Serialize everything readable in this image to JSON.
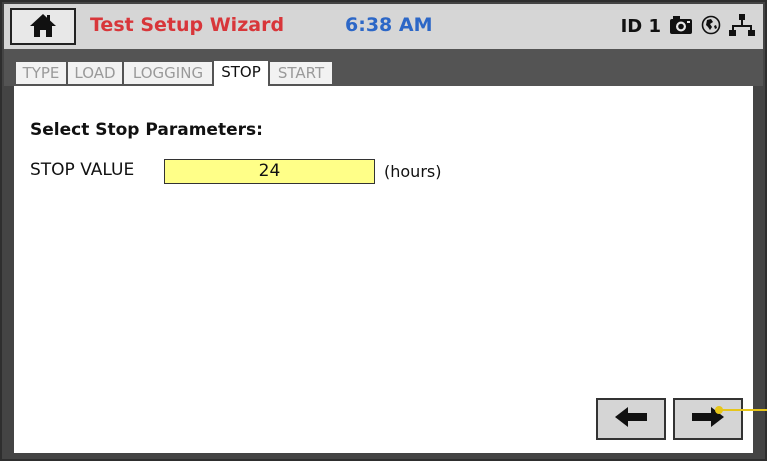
{
  "header": {
    "title": "Test Setup Wizard",
    "time": "6:38 AM",
    "id_label": "ID 1",
    "icons": [
      "home-icon",
      "camera-icon",
      "globe-icon",
      "network-icon"
    ]
  },
  "tabs": [
    {
      "label": "TYPE",
      "active": false
    },
    {
      "label": "LOAD",
      "active": false
    },
    {
      "label": "LOGGING",
      "active": false
    },
    {
      "label": "STOP",
      "active": true
    },
    {
      "label": "START",
      "active": false
    }
  ],
  "main": {
    "section_title": "Select Stop Parameters:",
    "stop_value_label": "STOP VALUE",
    "stop_value": "24",
    "unit": "(hours)"
  },
  "nav": {
    "back_icon": "arrow-left-icon",
    "next_icon": "arrow-right-icon"
  },
  "colors": {
    "title": "#d8363a",
    "time": "#2c67c7",
    "input_highlight": "#ffff88",
    "pointer": "#e6c51a"
  }
}
